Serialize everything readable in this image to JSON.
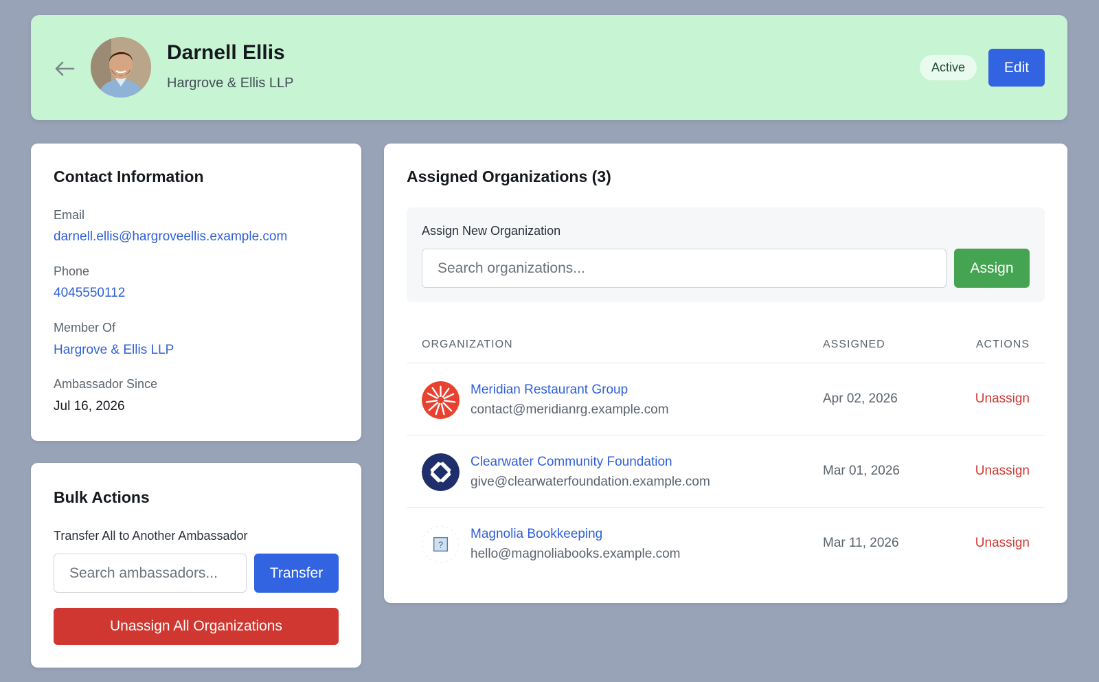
{
  "header": {
    "name": "Darnell Ellis",
    "organization": "Hargrove & Ellis LLP",
    "status": "Active",
    "edit_label": "Edit",
    "background_color": "#c7f4d3"
  },
  "contact": {
    "title": "Contact Information",
    "email_label": "Email",
    "email": "darnell.ellis@hargroveellis.example.com",
    "phone_label": "Phone",
    "phone": "4045550112",
    "member_of_label": "Member Of",
    "member_of": "Hargrove & Ellis LLP",
    "since_label": "Ambassador Since",
    "since": "Jul 16, 2026"
  },
  "bulk": {
    "title": "Bulk Actions",
    "transfer_label": "Transfer All to Another Ambassador",
    "search_placeholder": "Search ambassadors...",
    "transfer_button": "Transfer",
    "unassign_all_button": "Unassign All Organizations"
  },
  "orgs": {
    "title": "Assigned Organizations (3)",
    "assign_label": "Assign New Organization",
    "search_placeholder": "Search organizations...",
    "assign_button": "Assign",
    "columns": {
      "organization": "ORGANIZATION",
      "assigned": "ASSIGNED",
      "actions": "ACTIONS"
    },
    "rows": [
      {
        "name": "Meridian Restaurant Group",
        "email": "contact@meridianrg.example.com",
        "date": "Apr 02, 2026",
        "action": "Unassign",
        "logo": "red-starburst-logo"
      },
      {
        "name": "Clearwater Community Foundation",
        "email": "give@clearwaterfoundation.example.com",
        "date": "Mar 01, 2026",
        "action": "Unassign",
        "logo": "navy-diamond-logo"
      },
      {
        "name": "Magnolia Bookkeeping",
        "email": "hello@magnoliabooks.example.com",
        "date": "Mar 11, 2026",
        "action": "Unassign",
        "logo": "placeholder-image-logo"
      }
    ]
  },
  "colors": {
    "primary": "#3264e2",
    "success": "#45a452",
    "danger": "#cf3730",
    "link": "#2f5fd8"
  }
}
